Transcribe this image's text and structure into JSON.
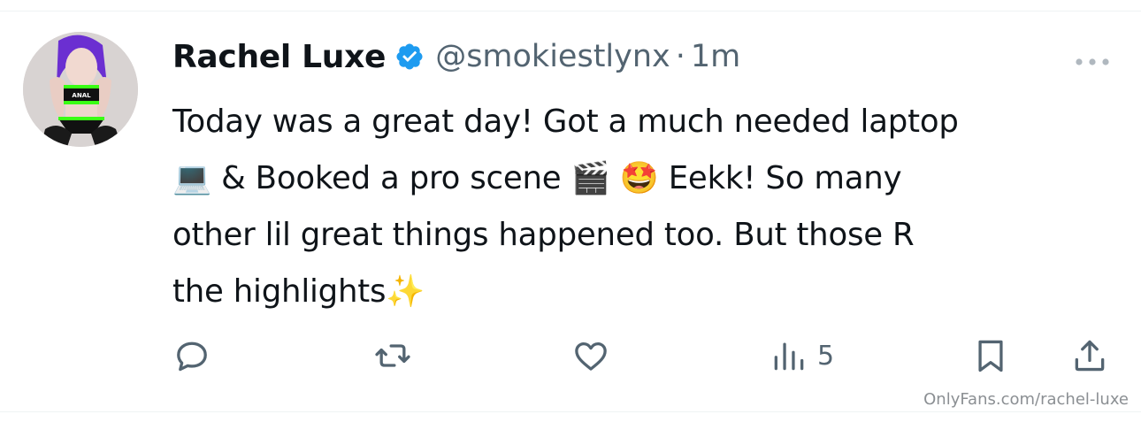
{
  "author": {
    "display_name": "Rachel Luxe",
    "handle": "@smokiestlynx",
    "separator": "·",
    "timestamp": "1m",
    "verified_icon": "verified-badge-icon",
    "avatar_accent_color": "#39ff14"
  },
  "tweet": {
    "text_line1": "Today was a great day! Got a much needed laptop",
    "text_line2": " & Booked a pro scene ",
    "emoji_laptop": "💻",
    "emoji_clapper": "🎬",
    "emoji_starstruck": "🤩",
    "text_line2b": " Eekk! So many",
    "text_line3": "other lil great things happened too. But those R",
    "text_line4": "the highlights",
    "emoji_sparkles": "✨"
  },
  "actions": {
    "reply_icon": "reply-icon",
    "retweet_icon": "retweet-icon",
    "like_icon": "like-icon",
    "views_icon": "views-icon",
    "views_count": "5",
    "bookmark_icon": "bookmark-icon",
    "share_icon": "share-icon"
  },
  "watermark": "OnlyFans.com/rachel-luxe",
  "colors": {
    "text": "#0f1419",
    "secondary": "#536471",
    "verified_blue": "#1d9bf0"
  }
}
